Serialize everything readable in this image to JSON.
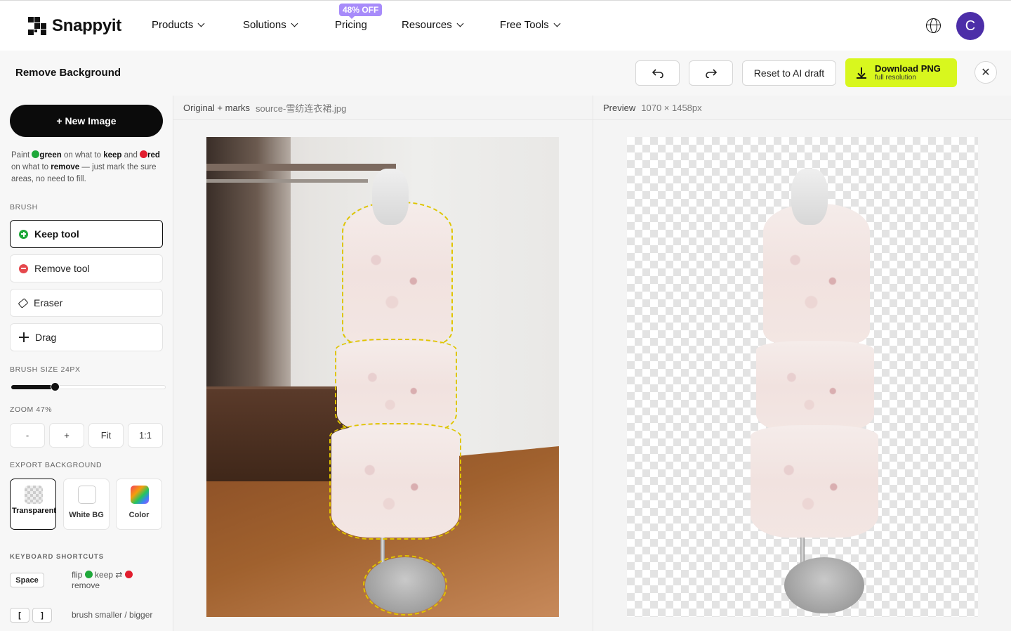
{
  "nav": {
    "logo_text": "Snappyit",
    "items": [
      {
        "label": "Products"
      },
      {
        "label": "Solutions"
      },
      {
        "label": "Pricing"
      },
      {
        "label": "Resources"
      },
      {
        "label": "Free Tools"
      }
    ],
    "promo_badge": "48% OFF",
    "avatar_initial": "C"
  },
  "toolbar": {
    "title": "Remove Background",
    "undo_icon": "undo-icon",
    "redo_icon": "redo-icon",
    "reset_label": "Reset to AI draft",
    "download_label": "Download PNG",
    "download_sub": "full resolution",
    "close_glyph": "✕",
    "accent_color": "#d8f71e"
  },
  "sidebar": {
    "new_image_label": "+ New Image",
    "help": {
      "paint": "Paint",
      "green": "green",
      "on_what_to": "on what to",
      "keep": "keep",
      "and": "and",
      "red": "red",
      "on_what_to_2": "on what to",
      "remove": "remove",
      "rest": "— just mark the sure areas, no need to fill."
    },
    "brush_label": "BRUSH",
    "tools": [
      {
        "label": "Keep tool",
        "icon": "plus-circle-icon",
        "active": true
      },
      {
        "label": "Remove tool",
        "icon": "minus-circle-icon",
        "active": false
      },
      {
        "label": "Eraser",
        "icon": "eraser-icon",
        "active": false
      },
      {
        "label": "Drag",
        "icon": "move-icon",
        "active": false
      }
    ],
    "brush_size_label": "BRUSH SIZE 24PX",
    "brush_size_fraction": 0.28,
    "zoom_label": "ZOOM 47%",
    "zoom_buttons": [
      "-",
      "+",
      "Fit",
      "1:1"
    ],
    "export_bg_label": "EXPORT BACKGROUND",
    "bg_options": [
      {
        "label": "Transparent",
        "active": true
      },
      {
        "label": "White BG",
        "active": false
      },
      {
        "label": "Color",
        "active": false
      }
    ],
    "shortcuts_label": "KEYBOARD SHORTCUTS",
    "shortcuts": {
      "space_key": "Space",
      "space_desc_1": "flip",
      "space_desc_keep": "keep",
      "space_desc_arrow": "⇄",
      "space_desc_remove": "remove",
      "bracket_left": "[",
      "bracket_right": "]",
      "bracket_desc": "brush smaller / bigger"
    }
  },
  "original_panel": {
    "title": "Original + marks",
    "file": "source-雪纺连衣裙.jpg"
  },
  "preview_panel": {
    "title": "Preview",
    "dimensions": "1070 × 1458px"
  }
}
